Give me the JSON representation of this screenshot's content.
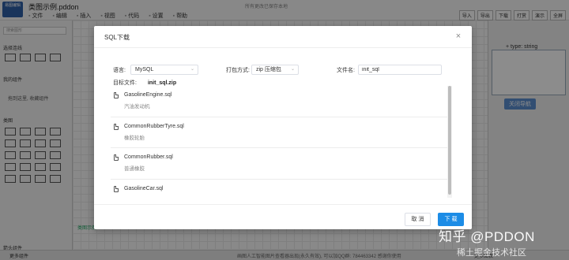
{
  "app": {
    "logo_text": "易图编辑",
    "file_title": "类图示例.pddon",
    "save_hint": "所有更改已保存本地",
    "menu": [
      "文件",
      "编辑",
      "插入",
      "视图",
      "代码",
      "设置",
      "帮助"
    ],
    "top_actions": [
      "导入",
      "导出",
      "下载",
      "打赏",
      "演示",
      "全屏"
    ],
    "left_search_placeholder": "搜索图形",
    "left_sections": [
      "选择连线",
      "我的组件",
      "类图",
      "箭头组件",
      "更多组件"
    ],
    "left_note": "拖到这里, 收藏组件",
    "canvas_tab": "类图示例",
    "right_type_label": "+ type: string",
    "right_nav_button": "关闭导航",
    "bottom_mid": "画图人工智能图片查看器出现(永久有效), 可以加QQ群: 784463342 感谢你使用",
    "bottom_right": "更多图表"
  },
  "dialog": {
    "title": "SQL下载",
    "close_icon": "×",
    "language_label": "语言:",
    "language_value": "MySQL",
    "package_label": "打包方式:",
    "package_value": "zip 压缩包",
    "filename_label": "文件名:",
    "filename_value": "init_sql",
    "target_label": "目标文件:",
    "target_value": "init_sql.zip",
    "files": [
      {
        "name": "GasolineEngine.sql",
        "desc": "汽油发动机"
      },
      {
        "name": "CommonRubberTyre.sql",
        "desc": "橡胶轮胎"
      },
      {
        "name": "CommonRubber.sql",
        "desc": "普通橡胶"
      },
      {
        "name": "GasolineCar.sql",
        "desc": ""
      }
    ],
    "cancel_label": "取 消",
    "download_label": "下 载"
  },
  "watermark": {
    "main": "知乎 @PDDON",
    "sub": "稀土掘金技术社区"
  }
}
